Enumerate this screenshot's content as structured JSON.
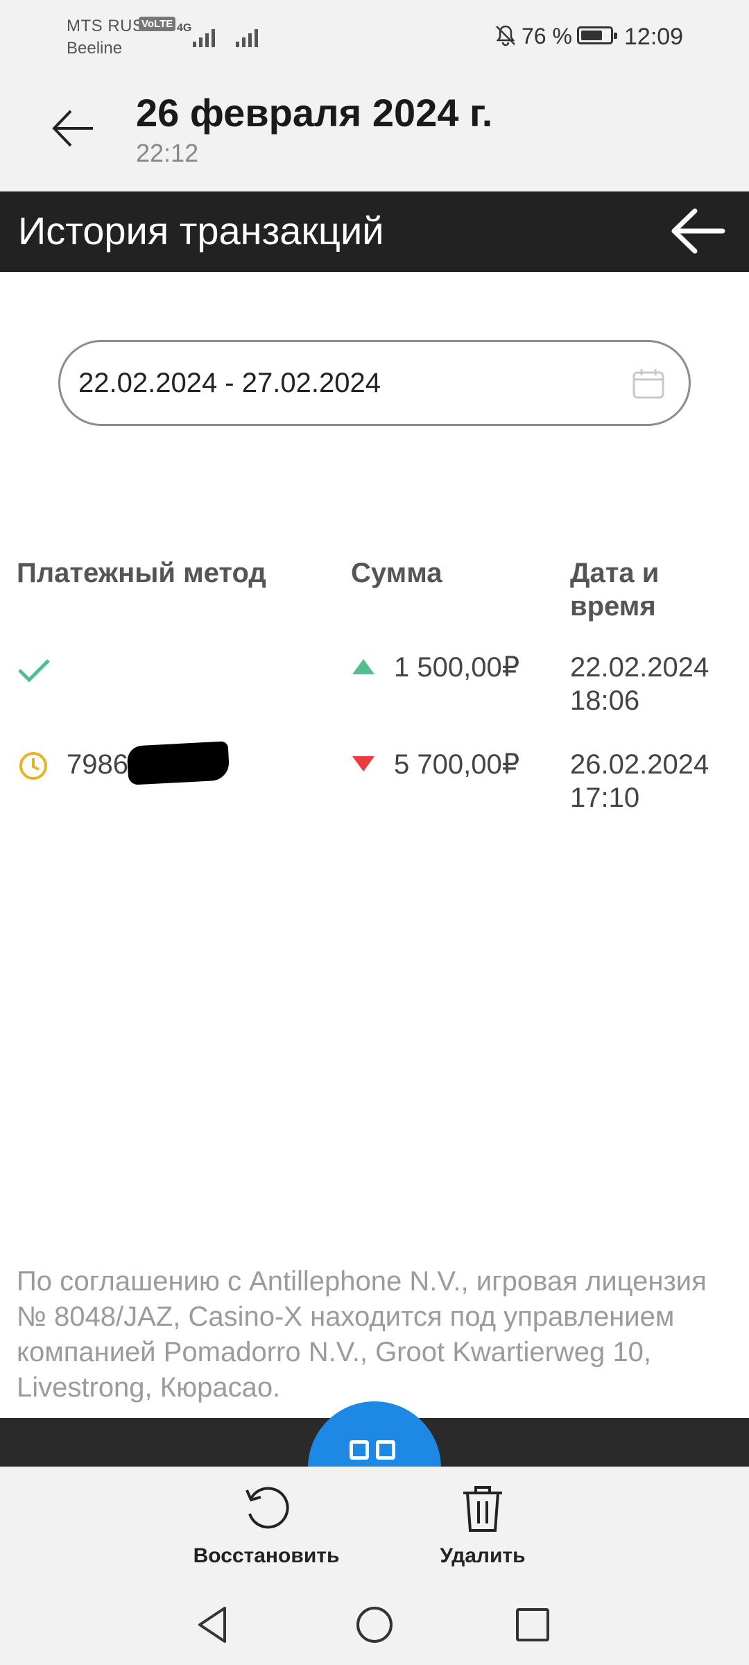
{
  "status_bar": {
    "carrier1": "MTS RUS",
    "volte": "VoLTE",
    "net": "4G",
    "carrier2": "Beeline",
    "battery": "76 %",
    "battery_level": 0.76,
    "time": "12:09"
  },
  "gallery_header": {
    "title": "26 февраля 2024 г.",
    "time": "22:12"
  },
  "app": {
    "title": "История транзакций",
    "date_range": "22.02.2024 - 27.02.2024",
    "columns": [
      "Платежный метод",
      "Сумма",
      "Дата и время"
    ],
    "rows": [
      {
        "status_icon": "check-icon",
        "method": "",
        "direction": "up",
        "amount": "1 500,00₽",
        "date": "22.02.2024",
        "time": "18:06"
      },
      {
        "status_icon": "clock-icon",
        "method": "7986 60",
        "direction": "down",
        "amount": "5 700,00₽",
        "date": "26.02.2024",
        "time": "17:10"
      }
    ],
    "footer": "По соглашению с Antillephone N.V., игровая лицензия № 8048/JAZ, Casino-X находится под управлением компанией Pomadorro N.V., Groot Kwartierweg 10, Livestrong, Кюрасао."
  },
  "actions": {
    "restore": "Восстановить",
    "delete": "Удалить"
  },
  "colors": {
    "header_bg": "#222222",
    "up": "#4fbf8f",
    "down": "#ee3a3a",
    "pending": "#e6b422",
    "fab": "#1e88e5"
  }
}
